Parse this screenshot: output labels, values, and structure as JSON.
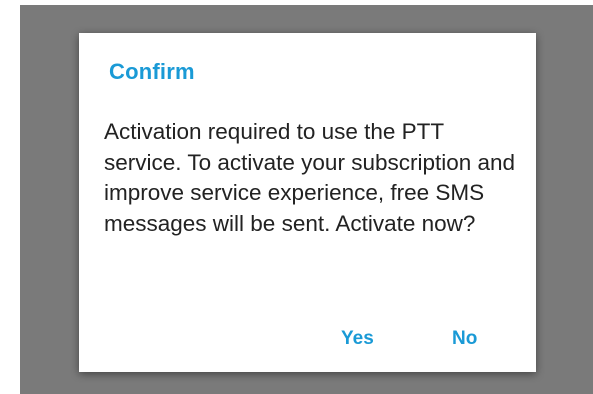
{
  "dialog": {
    "title": "Confirm",
    "message": "Activation required to use the PTT service. To activate your subscription and improve service experience, free SMS messages will be sent. Activate now?",
    "yes_label": "Yes",
    "no_label": "No"
  },
  "colors": {
    "accent": "#1a9ad6",
    "scrim": "#7a7a7a",
    "dialog_background": "#ffffff",
    "text": "#222222"
  }
}
